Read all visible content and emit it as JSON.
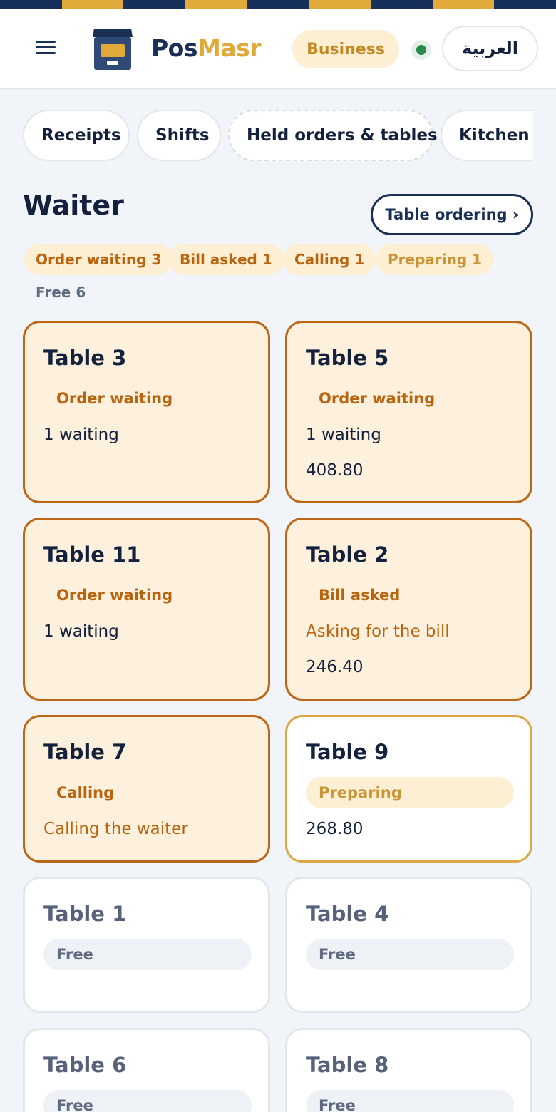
{
  "header": {
    "brand_part1": "Pos",
    "brand_part2": "Masr",
    "plan": "Business",
    "language_button": "العربية",
    "status": "online"
  },
  "nav_chips": [
    "Receipts",
    "Shifts",
    "Held orders & tables",
    "Kitchen b"
  ],
  "page": {
    "title": "Waiter",
    "table_ordering_button": "Table ordering ›"
  },
  "summary": {
    "order_waiting": "Order waiting 3",
    "bill_asked": "Bill asked 1",
    "calling": "Calling 1",
    "preparing": "Preparing 1",
    "free": "Free 6"
  },
  "tables": [
    {
      "name": "Table 3",
      "status": "Order waiting",
      "line1": "1 waiting",
      "line2": ""
    },
    {
      "name": "Table 5",
      "status": "Order waiting",
      "line1": "1 waiting",
      "line2": "408.80"
    },
    {
      "name": "Table 11",
      "status": "Order waiting",
      "line1": "1 waiting",
      "line2": ""
    },
    {
      "name": "Table 2",
      "status": "Bill asked",
      "line1": "Asking for the bill",
      "line2": "246.40"
    },
    {
      "name": "Table 7",
      "status": "Calling",
      "line1": "Calling the waiter",
      "line2": ""
    },
    {
      "name": "Table 9",
      "status": "Preparing",
      "line1": "268.80",
      "line2": ""
    },
    {
      "name": "Table 1",
      "status": "Free",
      "line1": "",
      "line2": ""
    },
    {
      "name": "Table 4",
      "status": "Free",
      "line1": "",
      "line2": ""
    },
    {
      "name": "Table 6",
      "status": "Free",
      "line1": "",
      "line2": ""
    },
    {
      "name": "Table 8",
      "status": "Free",
      "line1": "",
      "line2": ""
    }
  ],
  "colors": {
    "navy": "#1a2f55",
    "gold": "#e1a93a",
    "alert_border": "#bb6716",
    "alert_bg": "#fdf0dc",
    "online_green": "#27894a"
  }
}
